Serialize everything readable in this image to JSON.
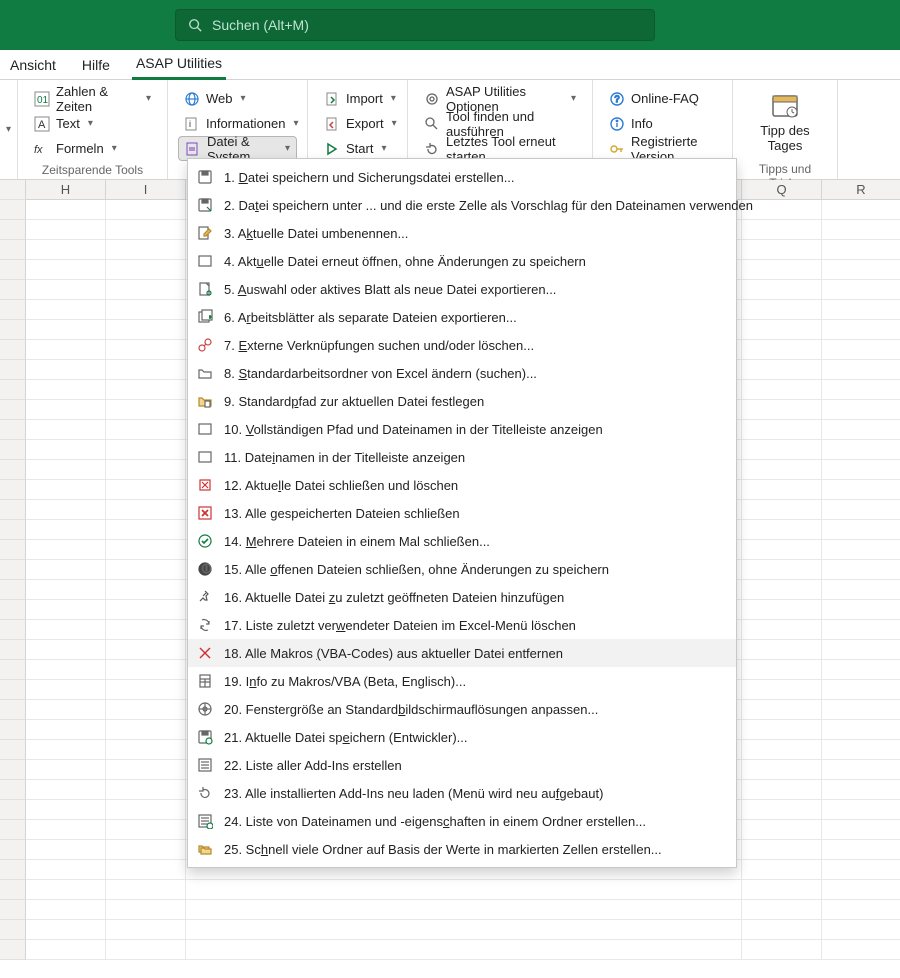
{
  "search": {
    "placeholder": "Suchen (Alt+M)"
  },
  "tabs": {
    "view": "Ansicht",
    "help": "Hilfe",
    "asap": "ASAP Utilities"
  },
  "ribbon": {
    "group1": {
      "numbers": "Zahlen & Zeiten",
      "text": "Text",
      "formulas": "Formeln",
      "label": "Zeitsparende Tools"
    },
    "group2": {
      "web": "Web",
      "info": "Informationen",
      "filesystem": "Datei & System"
    },
    "group3": {
      "import": "Import",
      "export": "Export",
      "start": "Start"
    },
    "group4": {
      "options": "ASAP Utilities Optionen",
      "find": "Tool finden und ausführen",
      "rerun": "Letztes Tool erneut starten"
    },
    "group5": {
      "faq": "Online-FAQ",
      "info": "Info",
      "reg": "Registrierte Version"
    },
    "group6": {
      "tip1": "Tipp des",
      "tip2": "Tages",
      "label": "Tipps und Tricks"
    }
  },
  "columns": [
    "H",
    "I",
    "Q",
    "R"
  ],
  "menu": [
    {
      "n": "1.",
      "pre": "",
      "u": "D",
      "post": "atei speichern und Sicherungsdatei erstellen...",
      "icon": "save"
    },
    {
      "n": "2.",
      "pre": "Da",
      "u": "t",
      "post": "ei speichern unter ... und die erste Zelle als Vorschlag für den Dateinamen verwenden",
      "icon": "saveas"
    },
    {
      "n": "3.",
      "pre": "A",
      "u": "k",
      "post": "tuelle Datei umbenennen...",
      "icon": "rename"
    },
    {
      "n": "4.",
      "pre": "Akt",
      "u": "u",
      "post": "elle Datei erneut öffnen, ohne Änderungen zu speichern",
      "icon": "box"
    },
    {
      "n": "5.",
      "pre": "",
      "u": "A",
      "post": "uswahl oder aktives Blatt als neue Datei exportieren...",
      "icon": "newfile"
    },
    {
      "n": "6.",
      "pre": "A",
      "u": "r",
      "post": "beitsblätter als separate Dateien exportieren...",
      "icon": "sheets"
    },
    {
      "n": "7.",
      "pre": "",
      "u": "E",
      "post": "xterne Verknüpfungen suchen und/oder löschen...",
      "icon": "links"
    },
    {
      "n": "8.",
      "pre": "",
      "u": "S",
      "post": "tandardarbeitsordner von Excel ändern (suchen)...",
      "icon": "folder"
    },
    {
      "n": "9.",
      "pre": "Standard",
      "u": "p",
      "post": "fad zur aktuellen Datei festlegen",
      "icon": "folderfile"
    },
    {
      "n": "10.",
      "pre": "",
      "u": "V",
      "post": "ollständigen Pfad und Dateinamen in der Titelleiste anzeigen",
      "icon": "box"
    },
    {
      "n": "11.",
      "pre": "Date",
      "u": "i",
      "post": "namen in der Titelleiste anzeigen",
      "icon": "box"
    },
    {
      "n": "12.",
      "pre": "Aktue",
      "u": "l",
      "post": "le Datei schließen und löschen",
      "icon": "del-red"
    },
    {
      "n": "13.",
      "pre": "Alle ",
      "u": "g",
      "post": "espeicherten Dateien schließen",
      "icon": "xred"
    },
    {
      "n": "14.",
      "pre": "",
      "u": "M",
      "post": "ehrere Dateien in einem Mal schließen...",
      "icon": "check"
    },
    {
      "n": "15.",
      "pre": "Alle ",
      "u": "o",
      "post": "ffenen Dateien schließen, ohne Änderungen zu speichern",
      "icon": "dark"
    },
    {
      "n": "16.",
      "pre": "Aktuelle Datei ",
      "u": "z",
      "post": "u zuletzt geöffneten Dateien hinzufügen",
      "icon": "pin"
    },
    {
      "n": "17.",
      "pre": "Liste zuletzt ver",
      "u": "w",
      "post": "endeter Dateien im Excel-Menü löschen",
      "icon": "recycle"
    },
    {
      "n": "18.",
      "pre": "Alle Makros ",
      "u": "(",
      "post": "VBA-Codes) aus aktueller Datei entfernen",
      "icon": "xthin",
      "hover": true
    },
    {
      "n": "19.",
      "pre": "I",
      "u": "n",
      "post": "fo zu Makros/VBA (Beta, Englisch)...",
      "icon": "calc"
    },
    {
      "n": "20.",
      "pre": "Fenstergröße an Standard",
      "u": "b",
      "post": "ildschirmauflösungen anpassen...",
      "icon": "wheel"
    },
    {
      "n": "21.",
      "pre": "Aktuelle Datei sp",
      "u": "e",
      "post": "ichern (Entwickler)...",
      "icon": "savedev"
    },
    {
      "n": "22.",
      "pre": "Liste aller Add-Ins erstellen",
      "u": "",
      "post": "",
      "icon": "list"
    },
    {
      "n": "23.",
      "pre": "Alle installierten Add-Ins neu laden (Menü wird neu au",
      "u": "f",
      "post": "gebaut)",
      "icon": "reload"
    },
    {
      "n": "24.",
      "pre": "Liste von Dateinamen und -eigens",
      "u": "c",
      "post": "haften in einem Ordner erstellen...",
      "icon": "listprops"
    },
    {
      "n": "25.",
      "pre": "Sc",
      "u": "h",
      "post": "nell viele Ordner auf Basis der Werte in markierten Zellen erstellen...",
      "icon": "folders"
    }
  ]
}
